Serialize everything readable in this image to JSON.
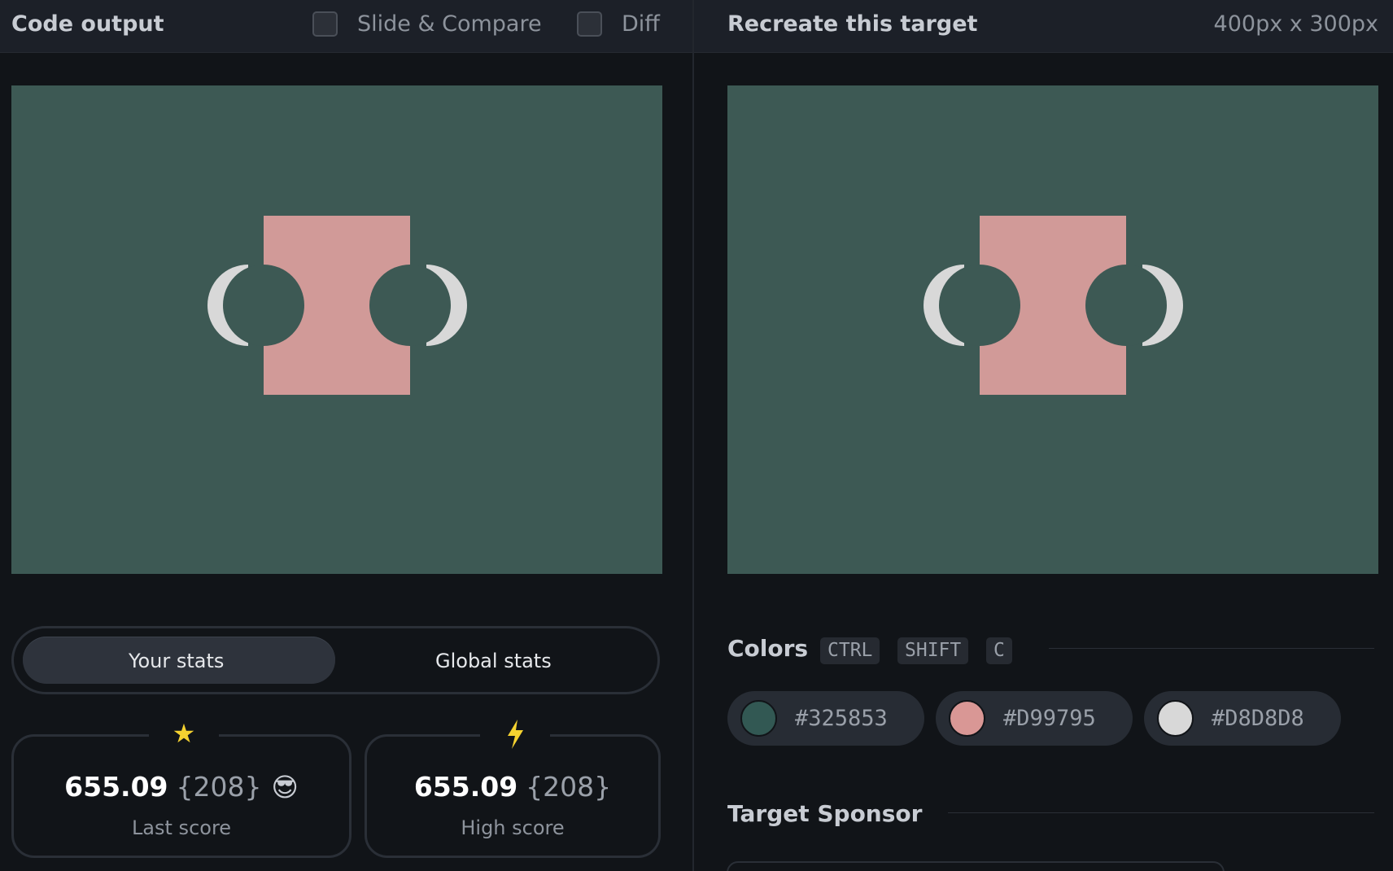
{
  "left": {
    "title": "Code output",
    "slide_compare_label": "Slide & Compare",
    "diff_label": "Diff",
    "stats_tabs": {
      "your_stats": "Your stats",
      "global_stats": "Global stats"
    },
    "last_score": {
      "value": "655.09",
      "count": "{208}",
      "emoji": "😎",
      "caption": "Last score",
      "icon": "star-icon"
    },
    "high_score": {
      "value": "655.09",
      "count": "{208}",
      "caption": "High score",
      "icon": "lightning-icon"
    }
  },
  "right": {
    "title": "Recreate this target",
    "dimensions": "400px x 300px",
    "colors_title": "Colors",
    "shortcut_keys": [
      "CTRL",
      "SHIFT",
      "C"
    ],
    "swatches": [
      {
        "hex": "#325853",
        "label": "#325853"
      },
      {
        "hex": "#D99795",
        "label": "#D99795"
      },
      {
        "hex": "#D8D8D8",
        "label": "#D8D8D8"
      }
    ],
    "sponsor_title": "Target Sponsor"
  }
}
